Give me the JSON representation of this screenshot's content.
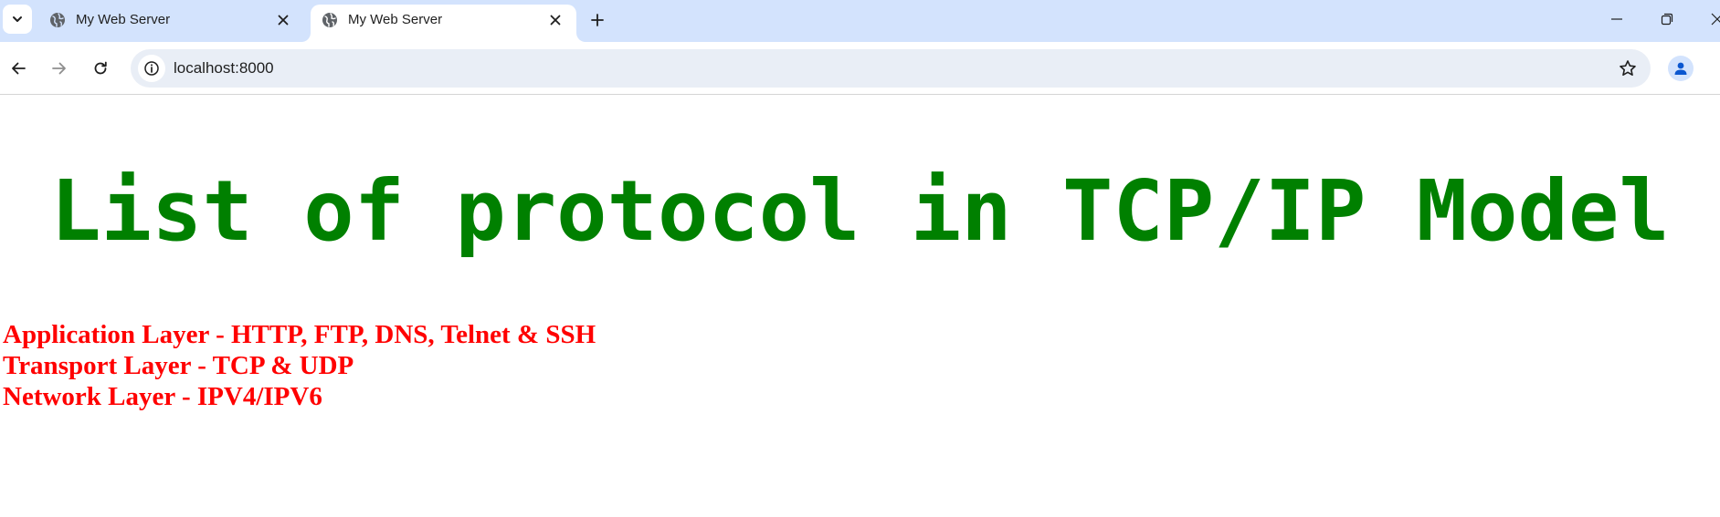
{
  "browser": {
    "tabs": [
      {
        "title": "My Web Server",
        "active": false
      },
      {
        "title": "My Web Server",
        "active": true
      }
    ],
    "address_bar": {
      "url": "localhost:8000"
    },
    "icons": {
      "tab_search": "chevron-down-icon",
      "favicon": "globe-icon",
      "tab_close": "close-icon",
      "new_tab": "plus-icon",
      "minimize": "minimize-icon",
      "restore": "restore-icon",
      "window_close": "close-icon",
      "back": "arrow-left-icon",
      "forward": "arrow-right-icon",
      "reload": "reload-icon",
      "site_info": "info-icon",
      "bookmark": "star-icon",
      "profile": "person-icon"
    },
    "colors": {
      "tabstrip_bg": "#d3e3fd",
      "omnibox_bg": "#e9eef6",
      "profile_accent": "#0b57d0"
    }
  },
  "page": {
    "heading": "List of protocol in TCP/IP Model",
    "heading_color": "#008000",
    "protocols": [
      "Application Layer - HTTP, FTP, DNS, Telnet & SSH",
      "Transport Layer - TCP & UDP",
      "Network Layer - IPV4/IPV6"
    ],
    "protocols_color": "#ff0000"
  }
}
